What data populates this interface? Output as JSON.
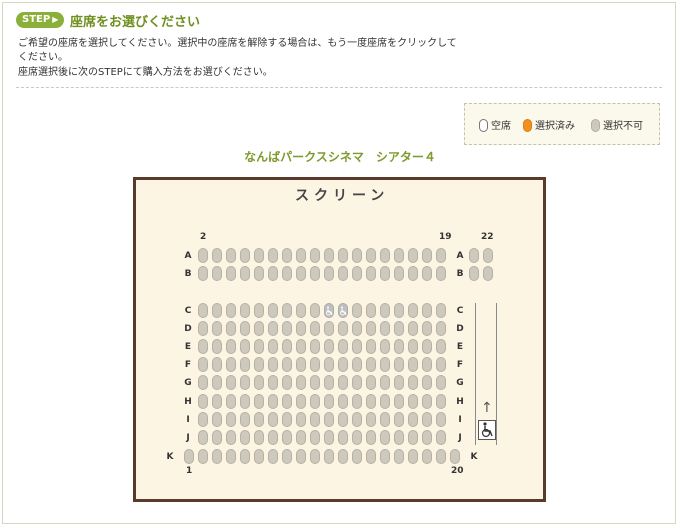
{
  "step": {
    "badge": "STEP",
    "title": "座席をお選びください"
  },
  "description": {
    "line1": "ご希望の座席を選択してください。選択中の座席を解除する場合は、もう一度座席をクリックして",
    "line2": "ください。",
    "line3": "座席選択後に次のSTEPにて購入方法をお選びください。"
  },
  "legend": {
    "available": "空席",
    "selected": "選択済み",
    "unavailable": "選択不可"
  },
  "theater_name": "なんばパークスシネマ　シアター４",
  "screen_label": "スクリーン",
  "column_numbers": {
    "left_top": "2",
    "center_top": "19",
    "right_top": "22",
    "bottom_left": "1",
    "bottom_right": "20"
  },
  "rows": {
    "top_block": [
      "A",
      "B"
    ],
    "main_block": [
      "C",
      "D",
      "E",
      "F",
      "G",
      "H",
      "I",
      "J"
    ],
    "last_row": "K"
  },
  "wheelchair_seats": [
    "C10",
    "C11"
  ],
  "colors": {
    "accent": "#8ab03a",
    "selected": "#f0901e",
    "seat": "#cdc9bd",
    "map_bg": "#fcf5e4",
    "map_border": "#5a3b2b"
  }
}
